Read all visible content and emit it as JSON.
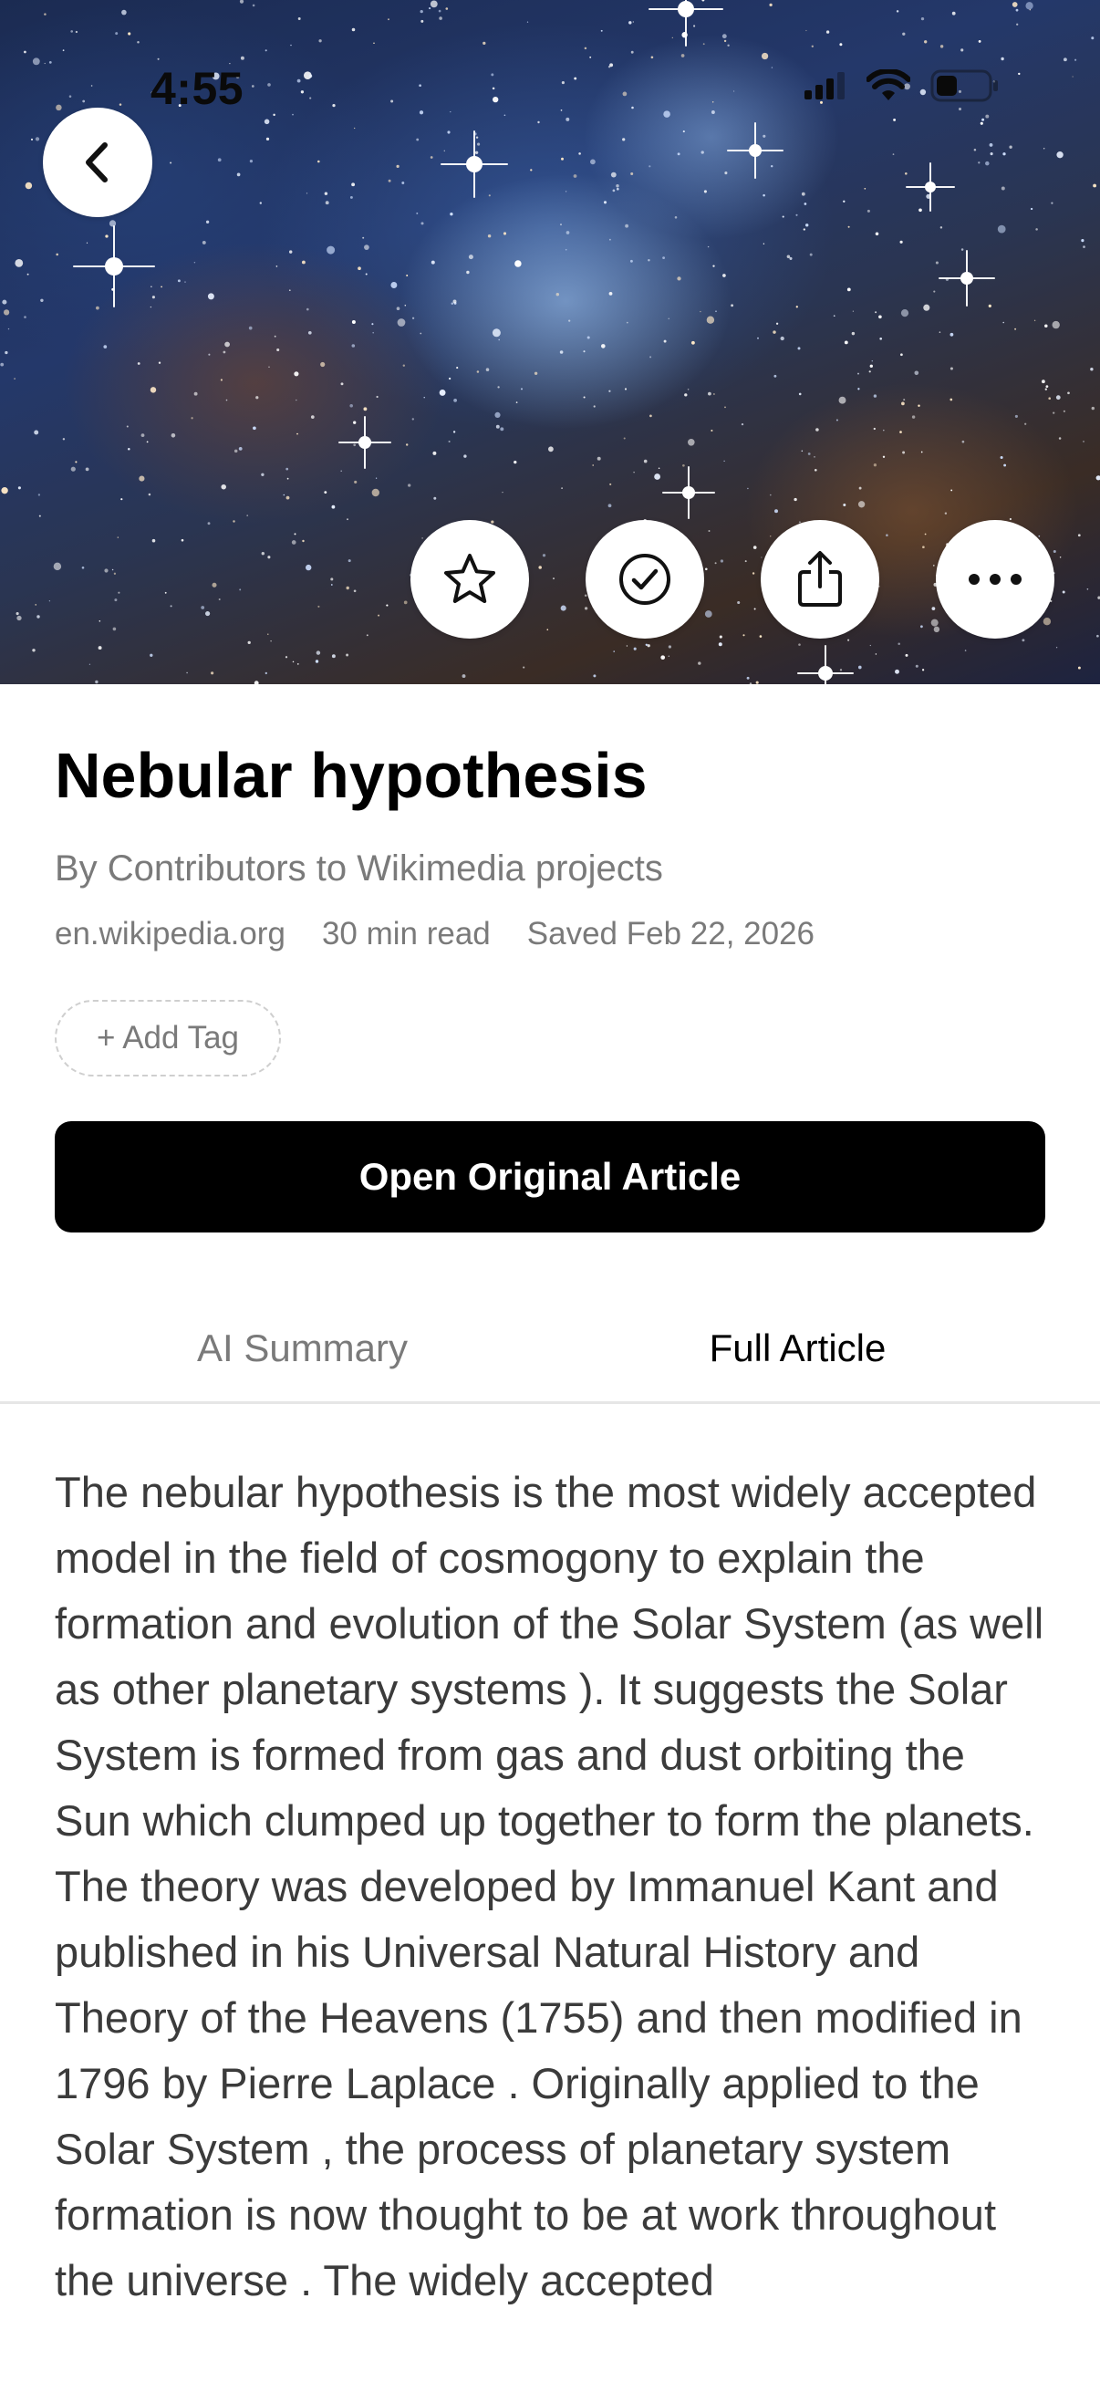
{
  "status_bar": {
    "time": "4:55"
  },
  "hero": {
    "image": "starfield-nebula"
  },
  "actions": {
    "back_icon": "chevron-left-icon",
    "favorite_icon": "star-outline-icon",
    "done_icon": "check-circle-icon",
    "share_icon": "share-icon",
    "more_icon": "ellipsis-icon"
  },
  "article": {
    "title": "Nebular hypothesis",
    "byline": "By Contributors to Wikimedia projects",
    "source": "en.wikipedia.org",
    "read_time": "30 min read",
    "saved": "Saved Feb 22, 2026",
    "add_tag_label": "+ Add Tag",
    "open_original_label": "Open Original Article",
    "body": "The nebular hypothesis is the most widely accepted model in the field of cosmogony to explain the formation and evolution of the Solar System (as well as other planetary systems ). It suggests the Solar System is formed from gas and dust orbiting the Sun which clumped up together to form the planets. The theory was developed by Immanuel Kant and published in his Universal Natural History and Theory of the Heavens (1755) and then modified in 1796 by Pierre Laplace . Originally applied to the Solar System , the process of planetary system formation is now thought to be at work throughout the universe . The widely accepted"
  },
  "tabs": {
    "summary_label": "AI Summary",
    "full_label": "Full Article",
    "active": "Full Article"
  },
  "colors": {
    "primary_button": "#000000",
    "muted_text": "#7a7a7a",
    "body_text": "#3b3b3b"
  }
}
